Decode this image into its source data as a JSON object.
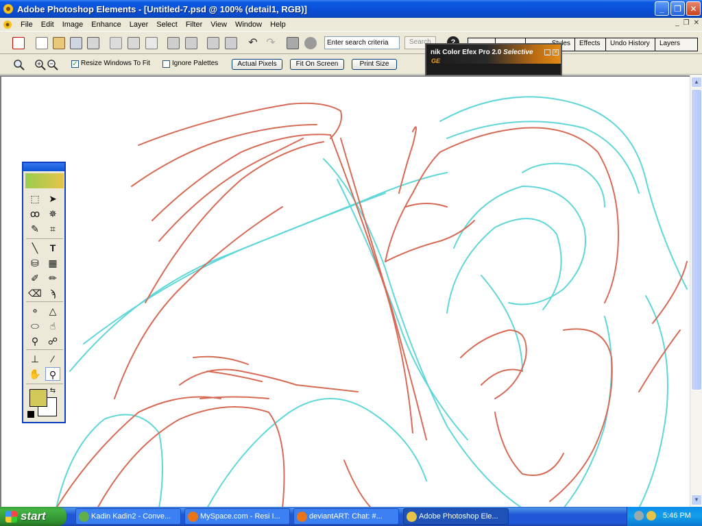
{
  "window": {
    "title": "Adobe Photoshop Elements - [Untitled-7.psd @ 100% (detail1, RGB)]",
    "min_label": "_",
    "max_label": "❐",
    "close_label": "✕"
  },
  "menu": {
    "items": [
      "File",
      "Edit",
      "Image",
      "Enhance",
      "Layer",
      "Select",
      "Filter",
      "View",
      "Window",
      "Help"
    ],
    "doc_controls": [
      "_",
      "❐",
      "✕"
    ]
  },
  "shortcuts": {
    "search_placeholder": "Enter search criteria",
    "search_value": "Enter search criteria",
    "search_button": "Search",
    "help_label": "?"
  },
  "palette_well": {
    "tabs": [
      "",
      "",
      "Styles",
      "Effects",
      "Undo History",
      "Layers"
    ]
  },
  "options_bar": {
    "resize_windows_label": "Resize Windows To Fit",
    "resize_windows_checked": true,
    "ignore_palettes_label": "Ignore Palettes",
    "ignore_palettes_checked": false,
    "actual_pixels_label": "Actual Pixels",
    "fit_on_screen_label": "Fit On Screen",
    "print_size_label": "Print Size"
  },
  "nik_panel": {
    "title": "nik Color Efex Pro 2.0",
    "title_italic": "Selective",
    "subtitle": "GE"
  },
  "toolbox": {
    "foreground_color": "#d3c85a",
    "background_color": "#ffffff",
    "active_tool": "zoom-tool",
    "tools": [
      {
        "name": "marquee-tool-icon",
        "glyph": "⬚"
      },
      {
        "name": "move-tool-icon",
        "glyph": "➤"
      },
      {
        "name": "lasso-tool-icon",
        "glyph": "ꝏ"
      },
      {
        "name": "magic-wand-tool-icon",
        "glyph": "✵"
      },
      {
        "name": "selection-brush-tool-icon",
        "glyph": "✎"
      },
      {
        "name": "crop-tool-icon",
        "glyph": "⌗"
      },
      {
        "name": "line-tool-icon",
        "glyph": "╲"
      },
      {
        "name": "type-tool-icon",
        "glyph": "T"
      },
      {
        "name": "paint-bucket-tool-icon",
        "glyph": "⛁"
      },
      {
        "name": "gradient-tool-icon",
        "glyph": "▦"
      },
      {
        "name": "brush-tool-icon",
        "glyph": "✐"
      },
      {
        "name": "pencil-tool-icon",
        "glyph": "✏"
      },
      {
        "name": "eraser-tool-icon",
        "glyph": "⌫"
      },
      {
        "name": "red-eye-brush-tool-icon",
        "glyph": "ϡ"
      },
      {
        "name": "blur-tool-icon",
        "glyph": "💧"
      },
      {
        "name": "sharpen-tool-icon",
        "glyph": "△"
      },
      {
        "name": "sponge-tool-icon",
        "glyph": "⬭"
      },
      {
        "name": "smudge-tool-icon",
        "glyph": "☝"
      },
      {
        "name": "dodge-tool-icon",
        "glyph": "⚲"
      },
      {
        "name": "burn-tool-icon",
        "glyph": "☍"
      },
      {
        "name": "clone-stamp-tool-icon",
        "glyph": "⊥"
      },
      {
        "name": "eyedropper-tool-icon",
        "glyph": "⁄"
      },
      {
        "name": "hand-tool-icon",
        "glyph": "✋"
      },
      {
        "name": "zoom-tool-icon",
        "glyph": "🔍"
      }
    ]
  },
  "taskbar": {
    "start_label": "start",
    "tasks": [
      {
        "label": "Kadin Kadin2 - Conve...",
        "icon_color": "#5fb04a",
        "active": false
      },
      {
        "label": "MySpace.com - Resi I...",
        "icon_color": "#e8751a",
        "active": false
      },
      {
        "label": "deviantART: Chat: #...",
        "icon_color": "#e8751a",
        "active": false
      },
      {
        "label": "Adobe Photoshop Ele...",
        "icon_color": "#e6c44a",
        "active": true
      }
    ],
    "clock": "5:46 PM"
  },
  "colors": {
    "sketch_red": "#d66a55",
    "sketch_cyan": "#5fd6d8",
    "titlebar_blue": "#0a4fd6"
  }
}
